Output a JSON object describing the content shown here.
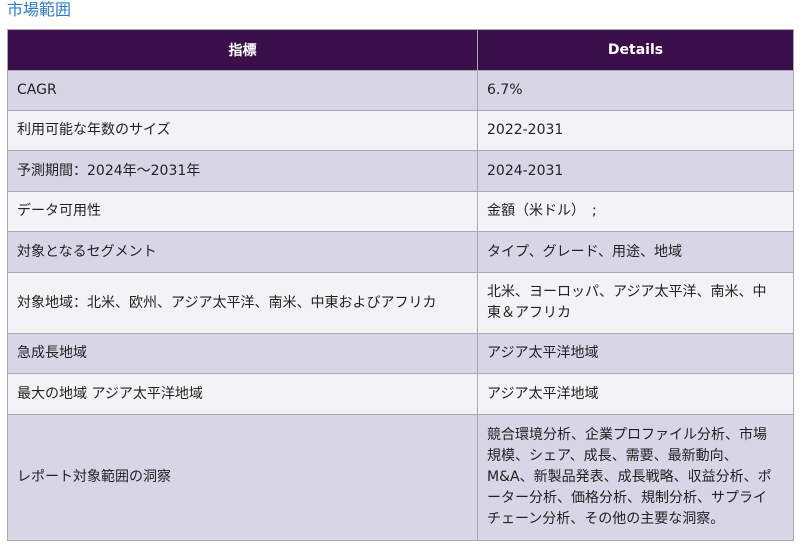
{
  "section_title": "市場範囲",
  "table": {
    "header": {
      "metric": "指標",
      "details": "Details"
    },
    "rows": [
      {
        "metric": "CAGR",
        "details": "6.7%"
      },
      {
        "metric": "利用可能な年数のサイズ",
        "details": "2022-2031"
      },
      {
        "metric": "予測期間：2024年～2031年",
        "details": "2024-2031"
      },
      {
        "metric": "データ可用性",
        "details": "金額（米ドル）　;"
      },
      {
        "metric": "対象となるセグメント",
        "details": "タイプ、グレード、用途、地域"
      },
      {
        "metric": "対象地域：北米、欧州、アジア太平洋、南米、中東およびアフリカ",
        "details": "北米、ヨーロッパ、アジア太平洋、南米、中東＆アフリカ"
      },
      {
        "metric": "急成長地域",
        "details": "アジア太平洋地域"
      },
      {
        "metric": "最大の地域 アジア太平洋地域",
        "details": "アジア太平洋地域"
      },
      {
        "metric": "レポート対象範囲の洞察",
        "details": "競合環境分析、企業プロファイル分析、市場規模、シェア、成長、需要、最新動向、M&A、新製品発表、成長戦略、収益分析、ポーター分析、価格分析、規制分析、サプライチェーン分析、その他の主要な洞察。"
      }
    ]
  }
}
